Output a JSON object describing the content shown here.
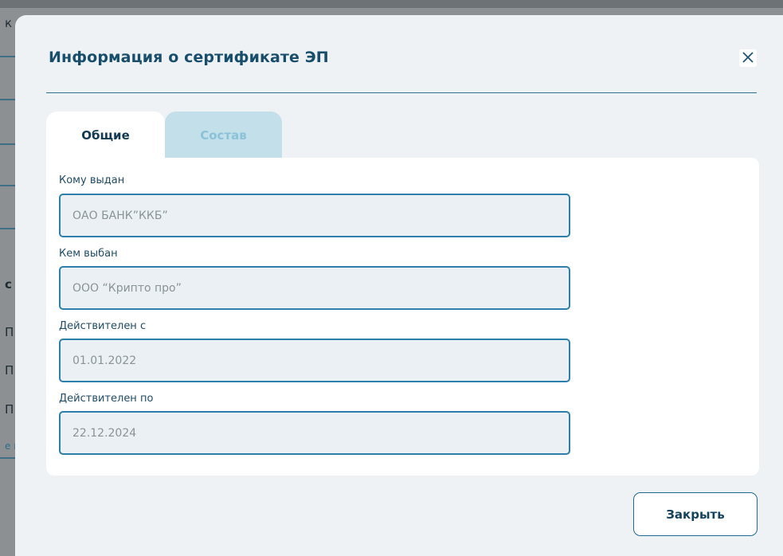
{
  "modal": {
    "title": "Информация о сертификате ЭП",
    "close_icon": "close-icon",
    "tabs": [
      {
        "label": "Общие",
        "active": true
      },
      {
        "label": "Состав",
        "active": false
      }
    ],
    "fields": [
      {
        "label": "Кому выдан",
        "value": "ОАО БАНК”ККБ”"
      },
      {
        "label": "Кем выбан",
        "value": "ООО “Крипто про”"
      },
      {
        "label": "Действителен с",
        "value": "01.01.2022"
      },
      {
        "label": "Действителен по",
        "value": "22.12.2024"
      }
    ],
    "footer": {
      "close_label": "Закрыть"
    }
  },
  "background": {
    "fragments": [
      "к",
      "с",
      "П:",
      "П:",
      "П:",
      "е п"
    ]
  },
  "colors": {
    "accent": "#2c7fab",
    "title": "#184e6b",
    "tab_inactive_bg": "#c3dfea",
    "input_bg": "#eaf0f3"
  }
}
